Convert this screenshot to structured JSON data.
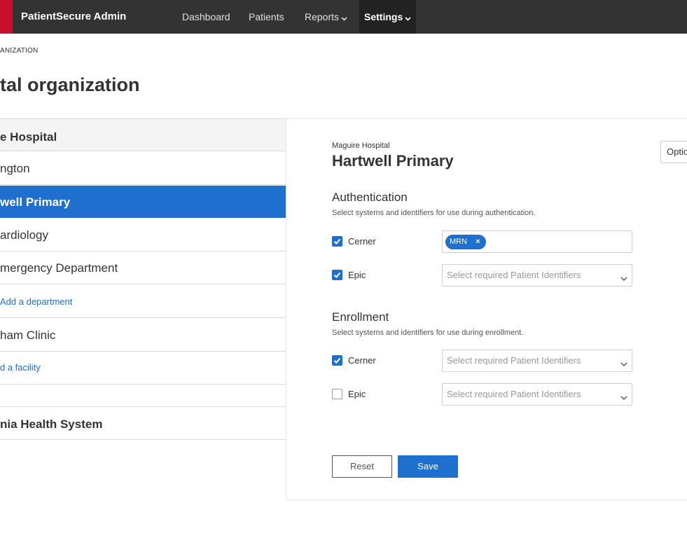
{
  "nav": {
    "brand": "PatientSecure Admin",
    "items": [
      "Dashboard",
      "Patients",
      "Reports",
      "Settings"
    ],
    "active": "Settings"
  },
  "breadcrumb": "ANIZATION",
  "page_title": "tal organization",
  "sidebar": {
    "rows": [
      {
        "label": "e Hospital",
        "kind": "hospital"
      },
      {
        "label": "ngton",
        "kind": "facility"
      },
      {
        "label": "well Primary",
        "kind": "selected"
      },
      {
        "label": "ardiology",
        "kind": "department"
      },
      {
        "label": "mergency Department",
        "kind": "department"
      },
      {
        "label": "Add a department",
        "kind": "link"
      },
      {
        "label": "ham Clinic",
        "kind": "facility"
      },
      {
        "label": "d a facility",
        "kind": "link"
      },
      {
        "label": "",
        "kind": "spacer"
      },
      {
        "label": "nia Health System",
        "kind": "hospital"
      }
    ]
  },
  "detail": {
    "parent": "Maguire Hospital",
    "title": "Hartwell Primary",
    "options_label": "Optio",
    "auth": {
      "title": "Authentication",
      "desc": "Select systems and identifiers for use during authentication.",
      "systems": [
        {
          "name": "Cerner",
          "checked": true,
          "tag": "MRN",
          "placeholder": ""
        },
        {
          "name": "Epic",
          "checked": true,
          "tag": "",
          "placeholder": "Select required Patient Identifiers"
        }
      ]
    },
    "enroll": {
      "title": "Enrollment",
      "desc": "Select systems and identifiers for use during enrollment.",
      "systems": [
        {
          "name": "Cerner",
          "checked": true,
          "placeholder": "Select required Patient Identifiers"
        },
        {
          "name": "Epic",
          "checked": false,
          "placeholder": "Select required Patient Identifiers"
        }
      ]
    },
    "reset_label": "Reset",
    "save_label": "Save"
  },
  "colors": {
    "accent": "#1f6fcf",
    "brand": "#c8102e",
    "nav_bg": "#333333"
  }
}
